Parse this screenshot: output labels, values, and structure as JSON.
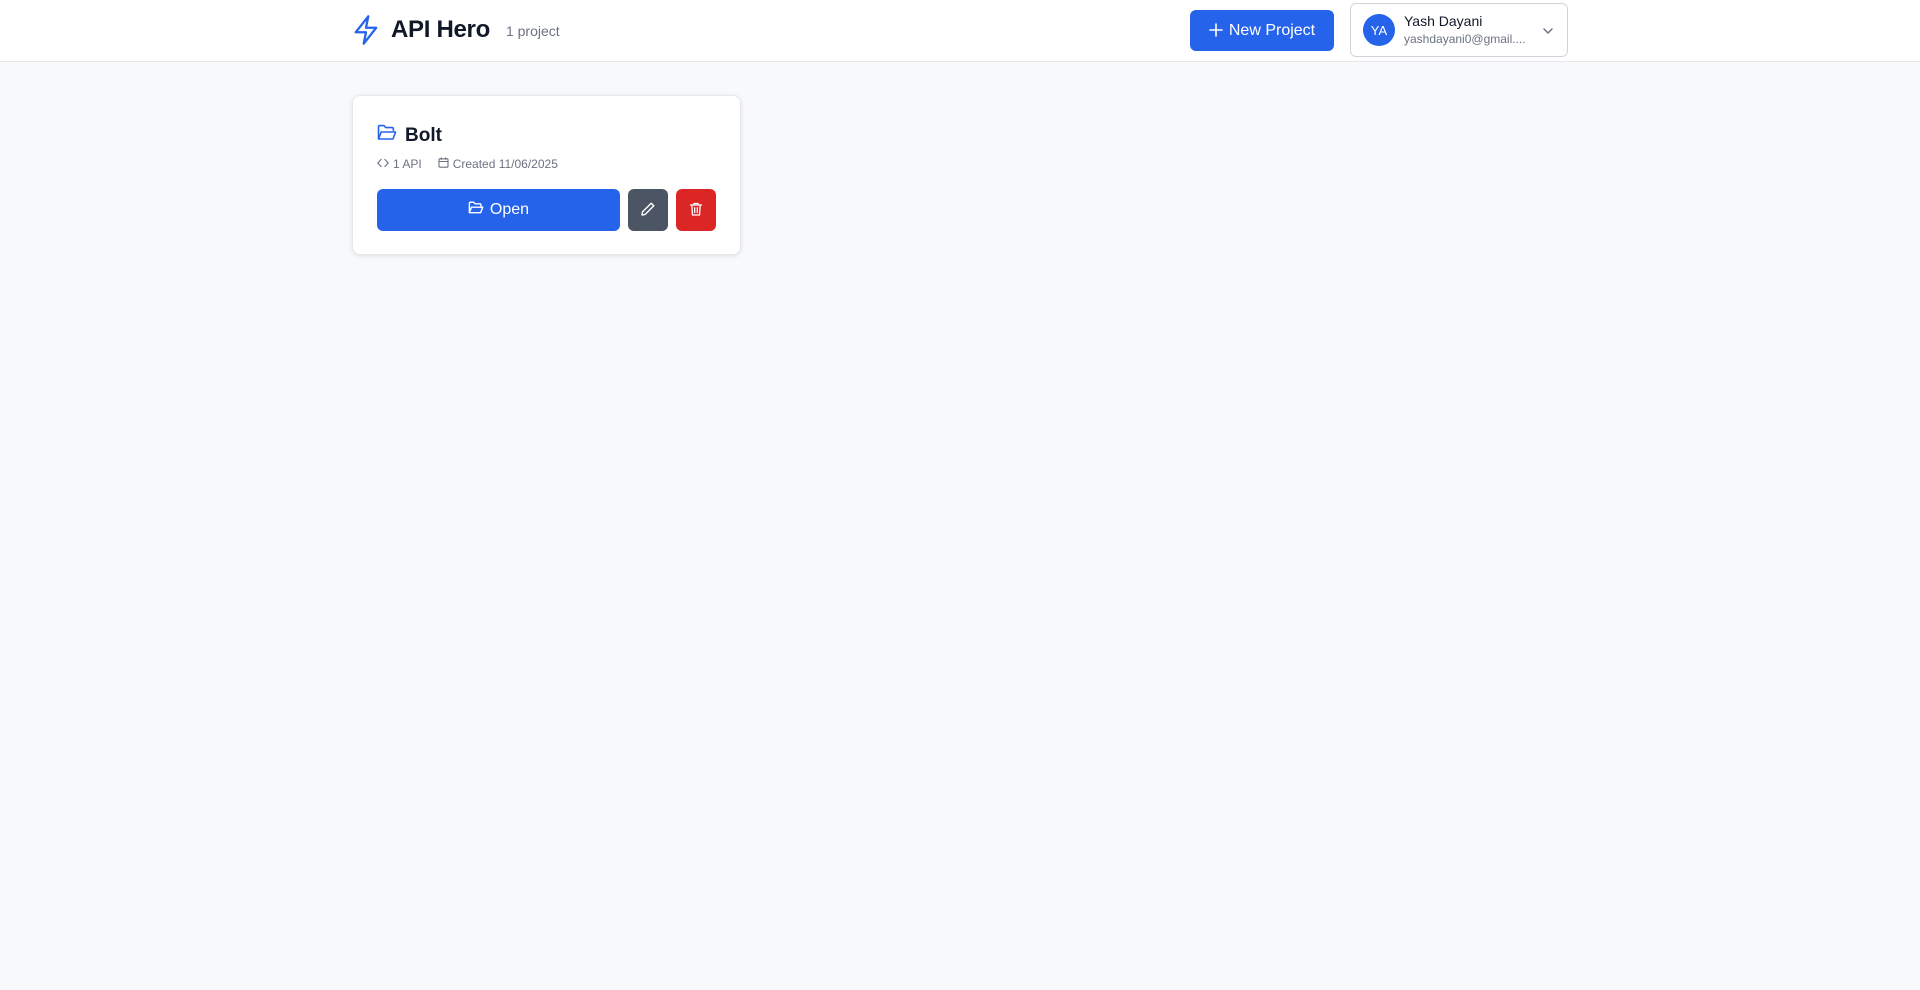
{
  "header": {
    "app_title": "API Hero",
    "project_count": "1 project",
    "new_project_label": "New Project",
    "user": {
      "initials": "YA",
      "name": "Yash Dayani",
      "email": "yashdayani0@gmail...."
    }
  },
  "projects": [
    {
      "name": "Bolt",
      "api_count": "1 API",
      "created": "Created 11/06/2025",
      "open_label": "Open"
    }
  ],
  "icons": {
    "brand": "lightning-bolt-icon",
    "plus": "plus-icon",
    "user_menu": "chevron-down-icon",
    "project": "folder-open-icon",
    "api": "code-icon",
    "date": "calendar-icon",
    "edit": "pencil-icon",
    "delete": "trash-icon"
  },
  "colors": {
    "primary": "#2563eb",
    "edit": "#4b5563",
    "danger": "#dc2626",
    "background": "#f8f9fb"
  }
}
